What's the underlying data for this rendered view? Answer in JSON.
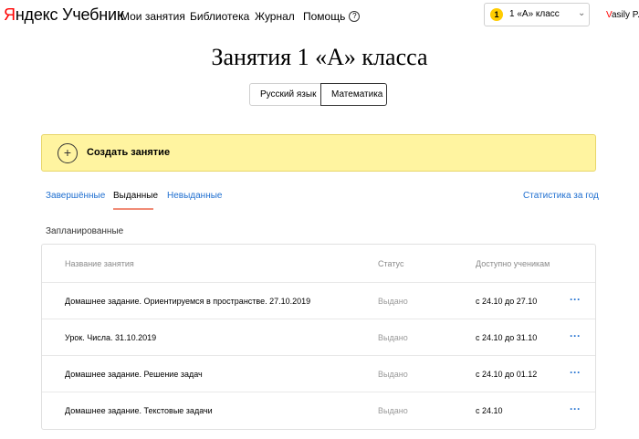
{
  "header": {
    "logo_ya": "Я",
    "logo_rest": "ндекс Учебник",
    "nav": [
      "Мои занятия",
      "Библиотека",
      "Журнал",
      "Помощь"
    ],
    "help_icon": "?",
    "class_select": {
      "badge": "1",
      "label": "1 «А» класс",
      "chevron": "⌄"
    },
    "user_first": "V",
    "user_rest": "asily P."
  },
  "title": "Занятия 1 «А» класса",
  "subjects": {
    "first": "Русский язык",
    "active": "Математика"
  },
  "create": {
    "plus": "+",
    "label": "Создать занятие"
  },
  "tabs": [
    "Завершённые",
    "Выданные",
    "Невыданные"
  ],
  "stats_link": "Статистика за год",
  "section_label": "Запланированные",
  "table": {
    "headers": {
      "name": "Название занятия",
      "status": "Статус",
      "avail": "Доступно ученикам"
    },
    "rows": [
      {
        "name": "Домашнее задание. Ориентируемся в пространстве. 27.10.2019",
        "status": "Выдано",
        "avail": "с 24.10 до 27.10",
        "more": "···"
      },
      {
        "name": "Урок. Числа. 31.10.2019",
        "status": "Выдано",
        "avail": "с 24.10 до 31.10",
        "more": "···"
      },
      {
        "name": "Домашнее задание. Решение задач",
        "status": "Выдано",
        "avail": "с 24.10 до 01.12",
        "more": "···"
      },
      {
        "name": "Домашнее задание. Текстовые задачи",
        "status": "Выдано",
        "avail": "с 24.10",
        "more": "···"
      }
    ]
  },
  "colors": {
    "accent_link": "#1f6fd0",
    "banner": "#fff4a0",
    "badge": "#ffcc00",
    "tab_underline": "#f08b76"
  }
}
